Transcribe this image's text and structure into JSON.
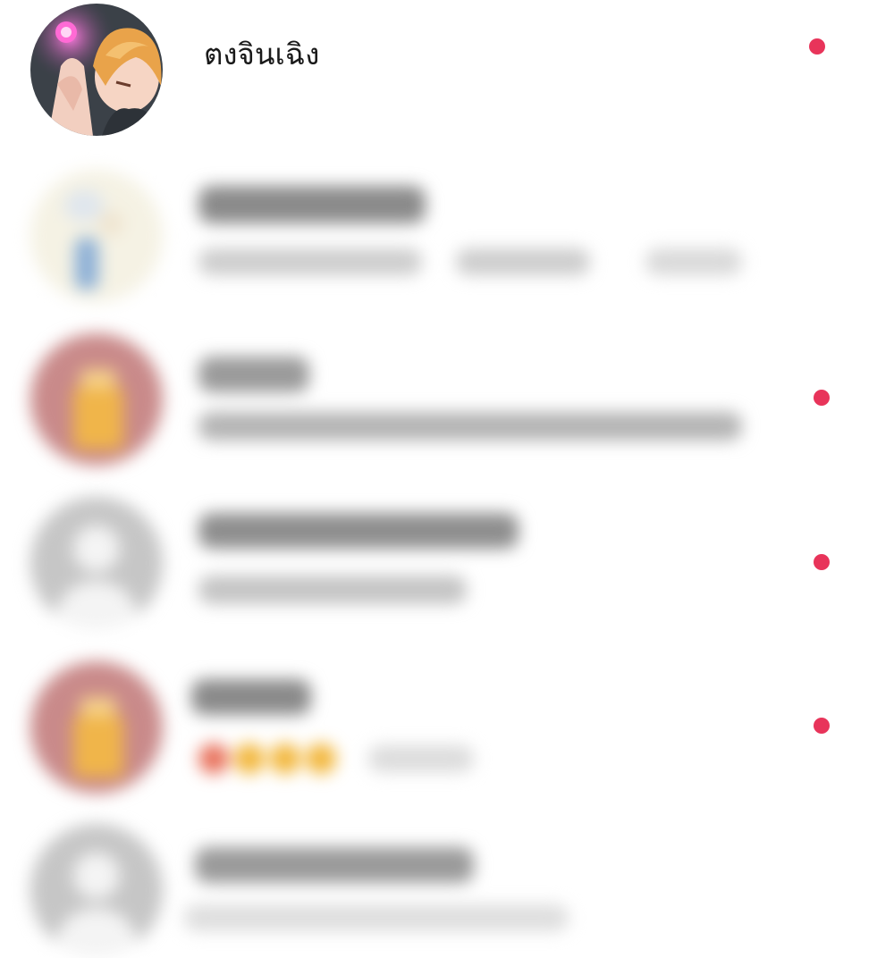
{
  "colors": {
    "unread_dot": "#e8345a",
    "placeholder_avatar": "#c9c9c9",
    "rose_avatar": "#c98a8a",
    "gift_box": "#f0b54a",
    "blur_text": "#8a8a8a",
    "blur_subtext": "#c4c4c4"
  },
  "chats": [
    {
      "name": "ตงจินเฉิง",
      "avatar_icon": "anime-profile-avatar",
      "unread": true
    },
    {
      "name": "",
      "avatar_icon": "pale-illustrated-avatar",
      "unread": false,
      "obscured": true
    },
    {
      "name": "",
      "avatar_icon": "rose-gift-avatar",
      "unread": true,
      "obscured": true
    },
    {
      "name": "",
      "avatar_icon": "default-person-avatar",
      "unread": true,
      "obscured": true
    },
    {
      "name": "",
      "avatar_icon": "rose-gift-avatar",
      "unread": true,
      "obscured": true
    },
    {
      "name": "",
      "avatar_icon": "default-person-avatar",
      "unread": false,
      "obscured": true
    }
  ]
}
